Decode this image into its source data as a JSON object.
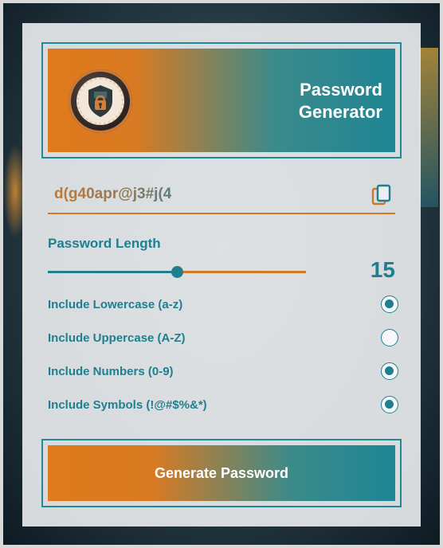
{
  "header": {
    "title_line1": "Password",
    "title_line2": "Generator",
    "logo_icon": "lock-shield-icon"
  },
  "password": {
    "value": "d(g40apr@j3#j(4",
    "copy_icon": "copy-icon"
  },
  "length": {
    "label": "Password Length",
    "value": "15",
    "slider_fraction": 0.5
  },
  "options": [
    {
      "label": "Include Lowercase (a-z)",
      "checked": true
    },
    {
      "label": "Include Uppercase (A-Z)",
      "checked": false
    },
    {
      "label": "Include Numbers (0-9)",
      "checked": true
    },
    {
      "label": "Include Symbols (!@#$%&*)",
      "checked": true
    }
  ],
  "generate_button": {
    "label": "Generate Password"
  },
  "colors": {
    "accent_teal": "#1f7f8f",
    "accent_orange": "#e07a1c"
  }
}
